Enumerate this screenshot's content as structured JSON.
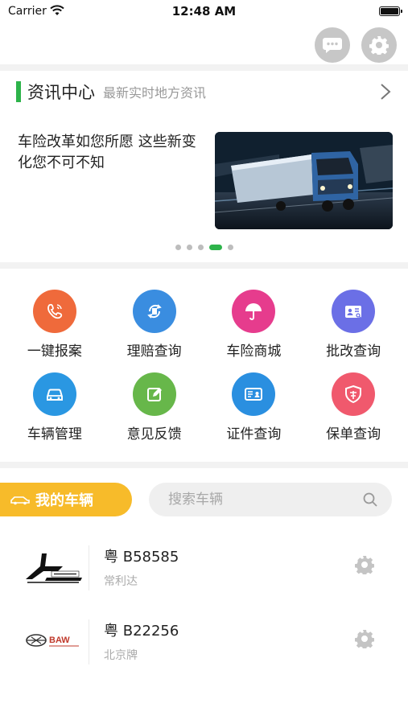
{
  "status_bar": {
    "carrier": "Carrier",
    "time": "12:48 AM"
  },
  "top_actions": {
    "message_icon": "chat-bubble-icon",
    "settings_icon": "gear-icon"
  },
  "news": {
    "title": "资讯中心",
    "subtitle": "最新实时地方资讯",
    "article_title": "车险改革如您所愿 这些新变化您不可不知",
    "carousel_total": 5,
    "carousel_active": 4
  },
  "grid": {
    "items": [
      {
        "label": "一键报案",
        "icon": "phone-icon",
        "color": "#ef6a3b"
      },
      {
        "label": "理赔查询",
        "icon": "claim-refresh-icon",
        "color": "#3a8de0"
      },
      {
        "label": "车险商城",
        "icon": "umbrella-icon",
        "color": "#e63c8d"
      },
      {
        "label": "批改查询",
        "icon": "id-card-search-icon",
        "color": "#6b6fe6"
      },
      {
        "label": "车辆管理",
        "icon": "car-icon",
        "color": "#2a97e2"
      },
      {
        "label": "意见反馈",
        "icon": "edit-icon",
        "color": "#67b74a"
      },
      {
        "label": "证件查询",
        "icon": "certificate-icon",
        "color": "#2a8fe0"
      },
      {
        "label": "保单查询",
        "icon": "policy-shield-icon",
        "color": "#f0596d"
      }
    ]
  },
  "vehicles": {
    "section_label": "我的车辆",
    "search_placeholder": "搜索车辆",
    "items": [
      {
        "plate": "粤 B58585",
        "brand": "常利达"
      },
      {
        "plate": "粤 B22256",
        "brand": "北京牌"
      }
    ]
  },
  "colors": {
    "accent_green": "#2db34a",
    "vehicle_yellow": "#f7bb2a",
    "round_button_gray": "#c7c7c7"
  }
}
